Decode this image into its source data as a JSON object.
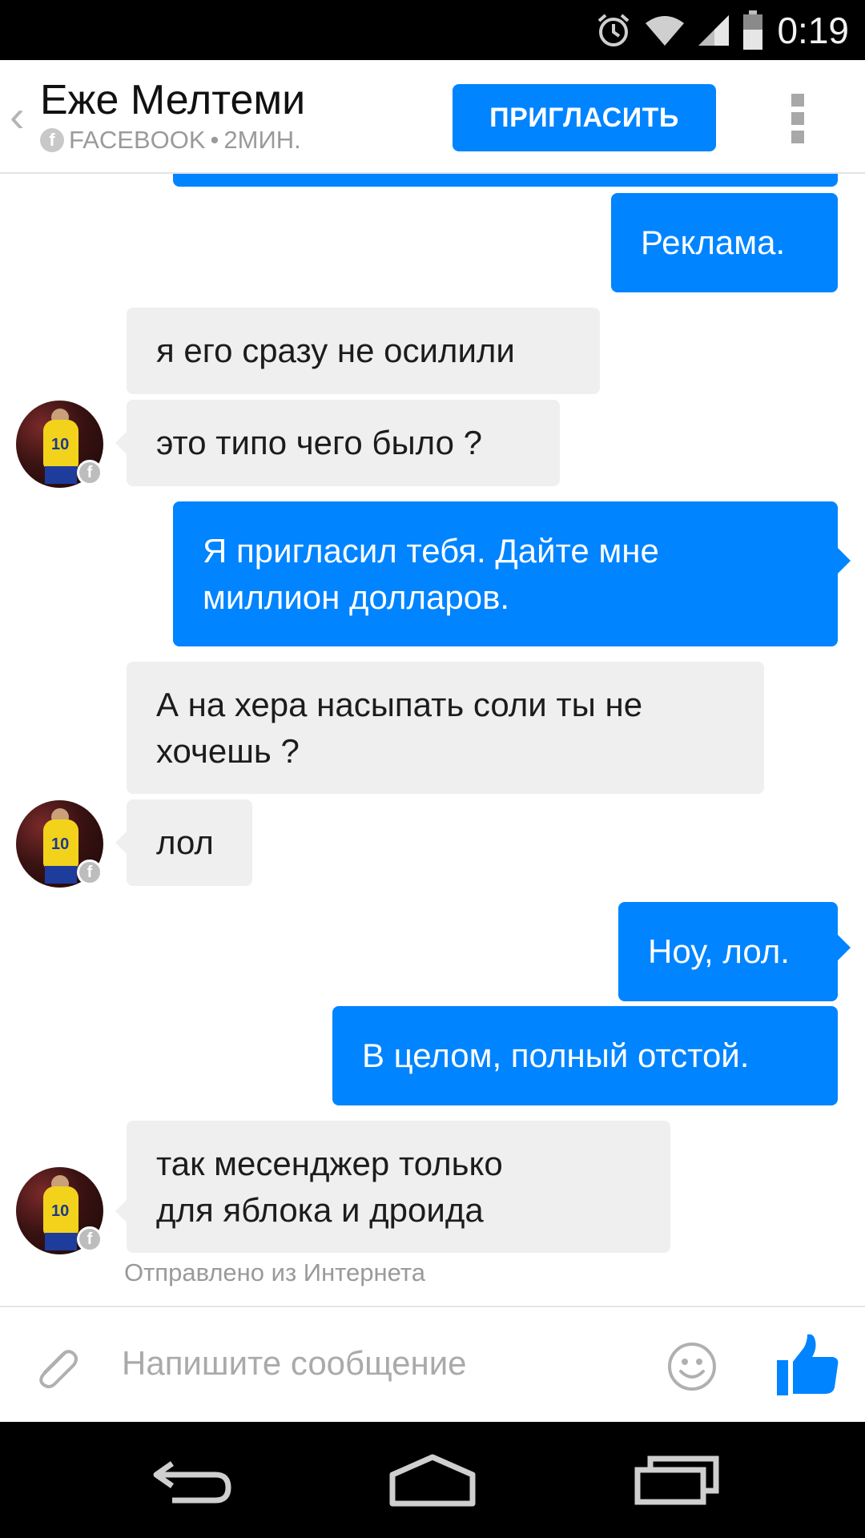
{
  "status_bar": {
    "time": "0:19",
    "icons": [
      "alarm-icon",
      "wifi-icon",
      "signal-icon",
      "battery-icon"
    ]
  },
  "header": {
    "contact_name": "Еже Мелтеми",
    "source": "FACEBOOK",
    "separator": "•",
    "last_active": "2МИН.",
    "invite_label": "ПРИГЛАСИТЬ"
  },
  "messages": [
    {
      "dir": "out",
      "text": "Реклама."
    },
    {
      "dir": "in",
      "text": "я его сразу не осилили"
    },
    {
      "dir": "in",
      "text": "это типо чего было ?"
    },
    {
      "dir": "out",
      "text": "Я пригласил тебя. Дайте мне\nмиллион долларов."
    },
    {
      "dir": "in",
      "text": "А на хера насыпать соли ты не\nхочешь ?"
    },
    {
      "dir": "in",
      "text": "лол"
    },
    {
      "dir": "out",
      "text": "Ноу, лол."
    },
    {
      "dir": "out",
      "text": "В целом, полный отстой."
    },
    {
      "dir": "in",
      "text": "так месенджер только\nдля яблока и дроида"
    }
  ],
  "avatar": {
    "jersey_number": "10"
  },
  "sent_from": "Отправлено из Интернета",
  "composer": {
    "placeholder": "Напишите сообщение"
  },
  "colors": {
    "accent": "#0084ff",
    "incoming_bubble": "#efefef"
  }
}
